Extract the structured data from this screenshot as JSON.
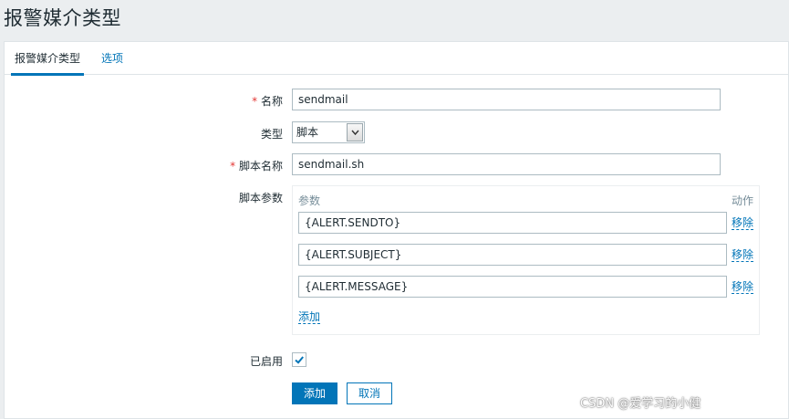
{
  "header": {
    "title": "报警媒介类型"
  },
  "tabs": [
    {
      "label": "报警媒介类型",
      "active": true
    },
    {
      "label": "选项",
      "active": false
    }
  ],
  "form": {
    "name_label": "名称",
    "name_value": "sendmail",
    "type_label": "类型",
    "type_selected": "脚本",
    "script_name_label": "脚本名称",
    "script_name_value": "sendmail.sh",
    "script_params_label": "脚本参数",
    "params_header": "参数",
    "action_header": "动作",
    "params": [
      {
        "value": "{ALERT.SENDTO}",
        "remove_label": "移除"
      },
      {
        "value": "{ALERT.SUBJECT}",
        "remove_label": "移除"
      },
      {
        "value": "{ALERT.MESSAGE}",
        "remove_label": "移除"
      }
    ],
    "add_param_label": "添加",
    "enabled_label": "已启用",
    "enabled": true
  },
  "buttons": {
    "add": "添加",
    "cancel": "取消"
  },
  "watermark": "CSDN @爱学习的小健",
  "colors": {
    "accent": "#0275b8",
    "required": "#e33734",
    "background": "#ebeef0"
  }
}
